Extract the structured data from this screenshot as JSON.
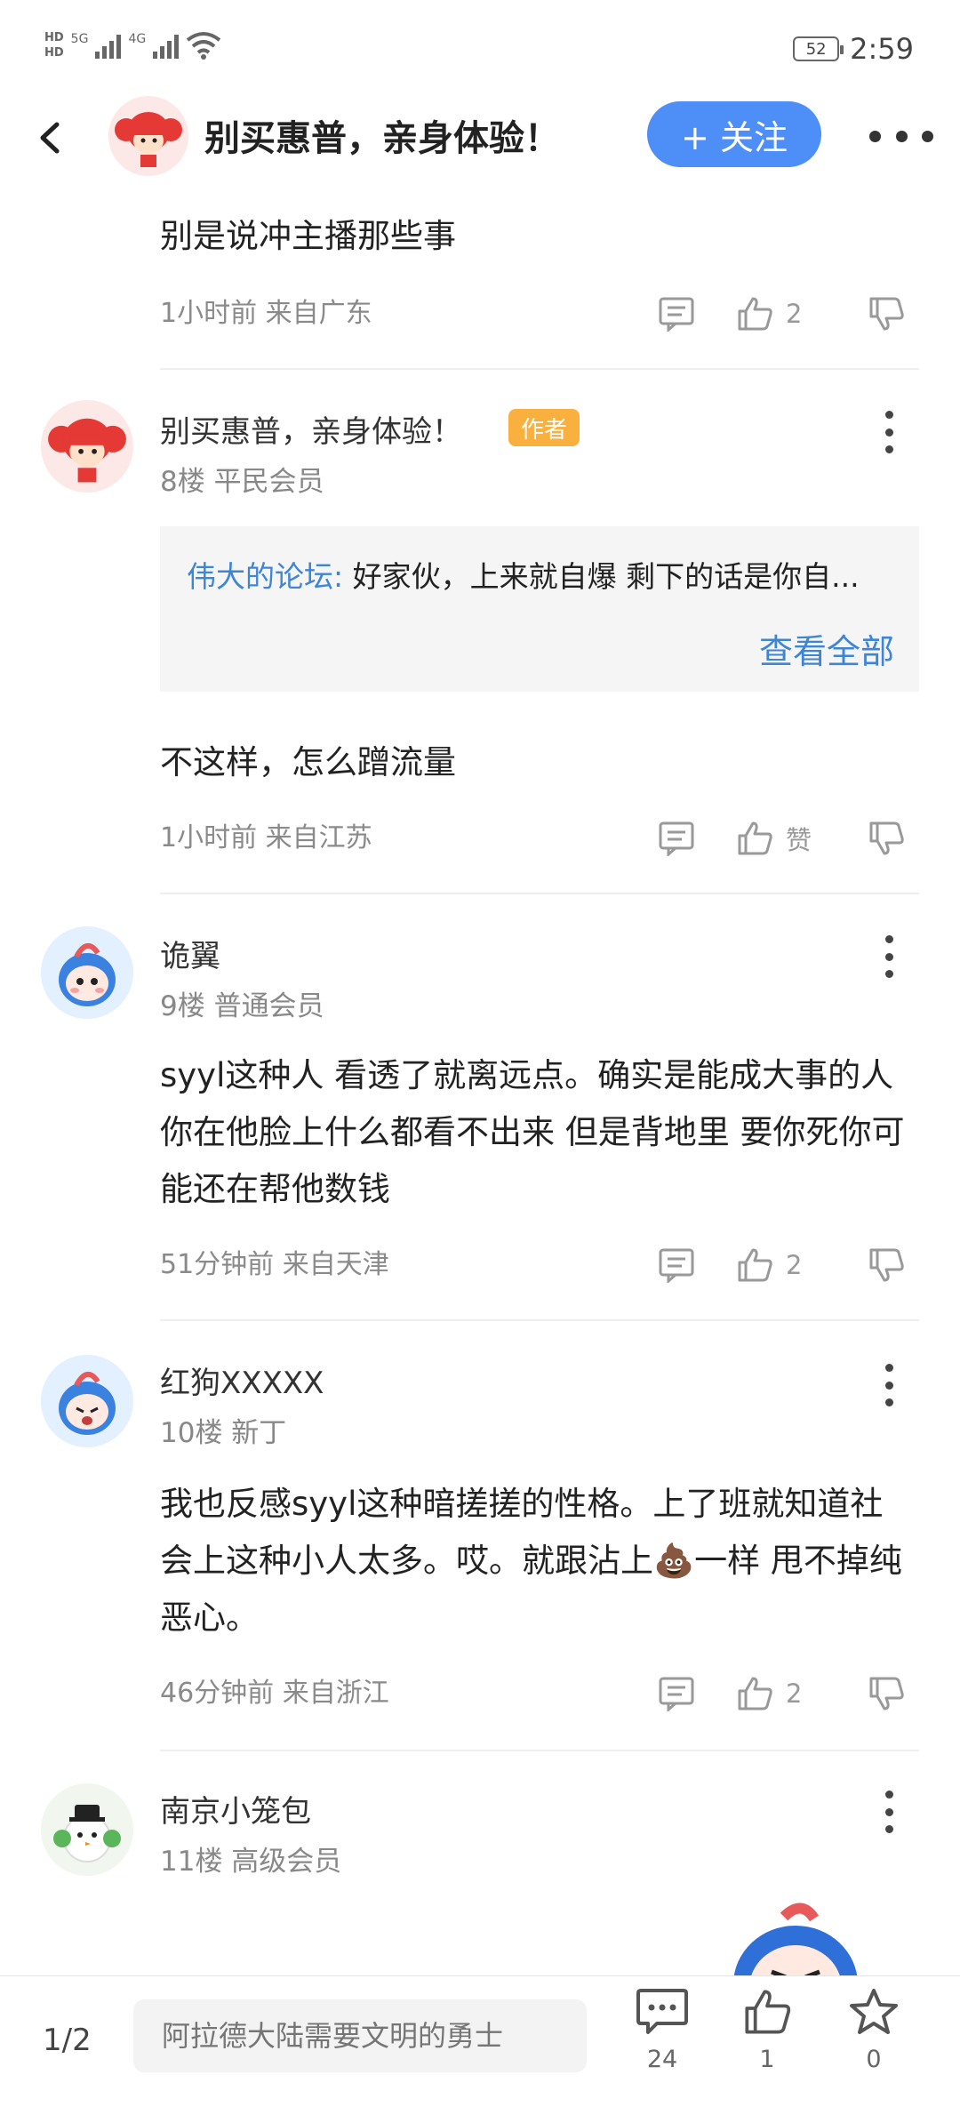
{
  "status_bar": {
    "hd1": "HD",
    "hd2": "HD",
    "net1": "5G",
    "net2": "4G",
    "battery": "52",
    "time": "2:59"
  },
  "header": {
    "title": "别买惠普，亲身体验！",
    "follow_label": "+ 关注"
  },
  "comments": [
    {
      "text_partial": "别是说冲主播那些事",
      "time_location": "1小时前 来自广东",
      "likes": "2"
    },
    {
      "name": "别买惠普，亲身体验！",
      "badge": "作者",
      "floor_level": "8楼 平民会员",
      "quote_user": "伟大的论坛:",
      "quote_text": " 好家伙，上来就自爆 剩下的话是你自...",
      "quote_more": "查看全部",
      "text": "不这样，怎么蹭流量",
      "time_location": "1小时前 来自江苏",
      "likes": "赞"
    },
    {
      "name": "诡翼",
      "floor_level": "9楼 普通会员",
      "text": "syyl这种人 看透了就离远点。确实是能成大事的人 你在他脸上什么都看不出来 但是背地里 要你死你可能还在帮他数钱",
      "time_location": "51分钟前 来自天津",
      "likes": "2"
    },
    {
      "name": "红狗XXXXX",
      "floor_level": "10楼 新丁",
      "text": "我也反感syyl这种暗搓搓的性格。上了班就知道社会上这种小人太多。哎。就跟沾上💩一样 甩不掉纯恶心。",
      "time_location": "46分钟前 来自浙江",
      "likes": "2"
    },
    {
      "name": "南京小笼包",
      "floor_level": "11楼 高级会员"
    }
  ],
  "bottom_bar": {
    "page_indicator": "1/2",
    "reply_placeholder": "阿拉德大陆需要文明的勇士",
    "comments_count": "24",
    "likes_count": "1",
    "favorites_count": "0"
  },
  "colors": {
    "accent": "#4e8ef7",
    "link": "#3f85d6",
    "author_badge": "#f9b03e"
  }
}
